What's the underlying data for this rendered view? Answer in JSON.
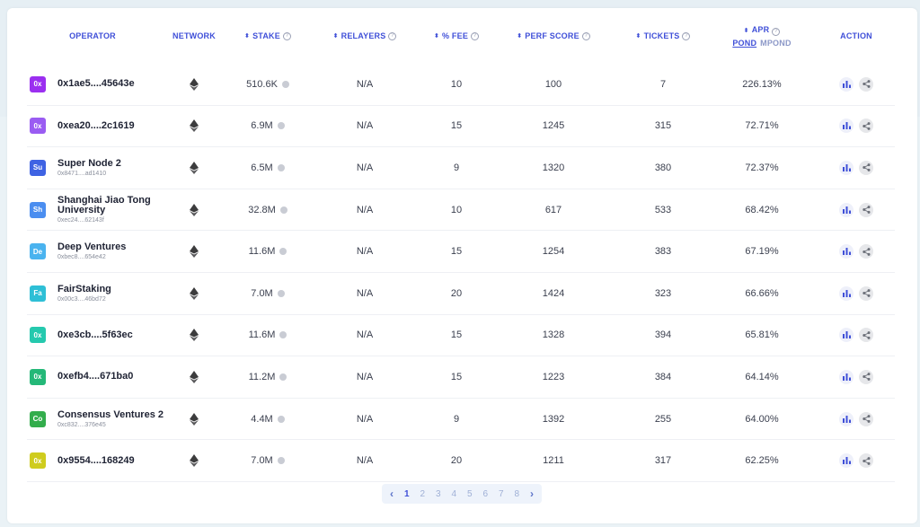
{
  "header": {
    "operator": "OPERATOR",
    "network": "NETWORK",
    "stake": "STAKE",
    "relayers": "RELAYERS",
    "fee": "% FEE",
    "perf": "PERF SCORE",
    "tickets": "TICKETS",
    "apr": "APR",
    "pond": "POND",
    "mpond": "MPond",
    "action": "ACTION"
  },
  "icons": {
    "sort": "sort-icon",
    "help": "help-circle-icon",
    "network": "ethereum-icon",
    "stats": "bar-chart-icon",
    "share": "share-icon",
    "info": "info-dot-icon"
  },
  "colors": {
    "accent": "#3f4fd8"
  },
  "rows": [
    {
      "initials": "0x",
      "color": "#9b2ff0",
      "name": "0x1ae5....45643e",
      "addr": "",
      "stake": "510.6K",
      "relayers": "N/A",
      "fee": "10",
      "perf": "100",
      "tickets": "7",
      "apr": "226.13%"
    },
    {
      "initials": "0x",
      "color": "#9a5cf2",
      "name": "0xea20....2c1619",
      "addr": "",
      "stake": "6.9M",
      "relayers": "N/A",
      "fee": "15",
      "perf": "1245",
      "tickets": "315",
      "apr": "72.71%"
    },
    {
      "initials": "Su",
      "color": "#3f63e3",
      "name": "Super Node 2",
      "addr": "0x8471....ad1410",
      "stake": "6.5M",
      "relayers": "N/A",
      "fee": "9",
      "perf": "1320",
      "tickets": "380",
      "apr": "72.37%"
    },
    {
      "initials": "Sh",
      "color": "#4b8ef0",
      "name": "Shanghai Jiao Tong University",
      "addr": "0xec24....62143f",
      "stake": "32.8M",
      "relayers": "N/A",
      "fee": "10",
      "perf": "617",
      "tickets": "533",
      "apr": "68.42%"
    },
    {
      "initials": "De",
      "color": "#4ab3ef",
      "name": "Deep Ventures",
      "addr": "0xbec8....654e42",
      "stake": "11.6M",
      "relayers": "N/A",
      "fee": "15",
      "perf": "1254",
      "tickets": "383",
      "apr": "67.19%"
    },
    {
      "initials": "Fa",
      "color": "#2ebfd6",
      "name": "FairStaking",
      "addr": "0x00c3....46bd72",
      "stake": "7.0M",
      "relayers": "N/A",
      "fee": "20",
      "perf": "1424",
      "tickets": "323",
      "apr": "66.66%"
    },
    {
      "initials": "0x",
      "color": "#25c9ae",
      "name": "0xe3cb....5f63ec",
      "addr": "",
      "stake": "11.6M",
      "relayers": "N/A",
      "fee": "15",
      "perf": "1328",
      "tickets": "394",
      "apr": "65.81%"
    },
    {
      "initials": "0x",
      "color": "#24b878",
      "name": "0xefb4....671ba0",
      "addr": "",
      "stake": "11.2M",
      "relayers": "N/A",
      "fee": "15",
      "perf": "1223",
      "tickets": "384",
      "apr": "64.14%"
    },
    {
      "initials": "Co",
      "color": "#33ad4c",
      "name": "Consensus Ventures 2",
      "addr": "0xc832....376e45",
      "stake": "4.4M",
      "relayers": "N/A",
      "fee": "9",
      "perf": "1392",
      "tickets": "255",
      "apr": "64.00%"
    },
    {
      "initials": "0x",
      "color": "#cfcc1e",
      "name": "0x9554....168249",
      "addr": "",
      "stake": "7.0M",
      "relayers": "N/A",
      "fee": "20",
      "perf": "1211",
      "tickets": "317",
      "apr": "62.25%"
    }
  ],
  "pagination": {
    "pages": [
      "1",
      "2",
      "3",
      "4",
      "5",
      "6",
      "7",
      "8"
    ],
    "current": "1",
    "prev": "‹",
    "next": "›"
  }
}
